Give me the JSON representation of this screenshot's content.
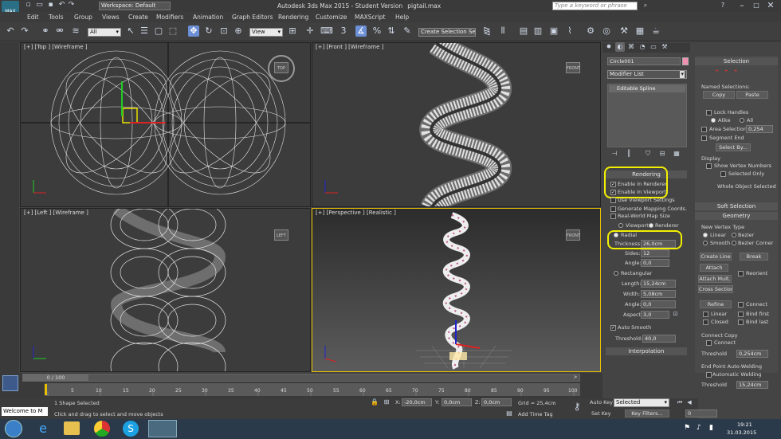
{
  "title": {
    "workspace": "Workspace: Default",
    "app": "Autodesk 3ds Max  2015  - Student Version",
    "file": "pigtail.max",
    "search_placeholder": "Type a keyword or phrase"
  },
  "menu": [
    "Edit",
    "Tools",
    "Group",
    "Views",
    "Create",
    "Modifiers",
    "Animation",
    "Graph Editors",
    "Rendering",
    "Customize",
    "MAXScript",
    "Help"
  ],
  "toolbar": {
    "filter": "All",
    "refcoord": "View",
    "selset": "Create Selection Se"
  },
  "viewports": {
    "top": "[+] [Top ] [Wireframe ]",
    "front": "[+] [Front ] [Wireframe ]",
    "left": "[+] [Left ] [Wireframe ]",
    "persp": "[+] [Perspective ] [Realistic ]"
  },
  "viewcube": {
    "top": "TOP",
    "front": "FRONT",
    "left": "LEFT",
    "persp": "FRONT"
  },
  "modify": {
    "object_name": "Circle001",
    "modifier_list": "Modifier List",
    "stack_item": "Editable Spline"
  },
  "rendering": {
    "header": "Rendering",
    "enable_renderer": "Enable In Renderer",
    "enable_viewport": "Enable In Viewport",
    "use_viewport": "Use Viewport Settings",
    "gen_mapping": "Generate Mapping Coords.",
    "real_world": "Real-World Map Size",
    "viewport": "Viewport",
    "renderer": "Renderer",
    "radial": "Radial",
    "thickness_label": "Thickness:",
    "thickness": "26,0cm",
    "sides_label": "Sides:",
    "sides": "12",
    "angle_label": "Angle:",
    "angle": "0,0",
    "rectangular": "Rectangular",
    "length_label": "Length:",
    "length": "15,24cm",
    "width_label": "Width:",
    "width": "5,08cm",
    "angle2_label": "Angle:",
    "angle2": "0,0",
    "aspect_label": "Aspect:",
    "aspect": "3,0",
    "auto_smooth": "Auto Smooth",
    "threshold_label": "Threshold:",
    "threshold": "40,0",
    "interpolation": "Interpolation"
  },
  "selection": {
    "header": "Selection",
    "named_sel": "Named Selections:",
    "copy": "Copy",
    "paste": "Paste",
    "lock_handles": "Lock Handles",
    "alike": "Alike",
    "all": "All",
    "area_sel": "Area Selection:",
    "area_val": "0,254",
    "segment_end": "Segment End",
    "select_by": "Select By...",
    "display": "Display",
    "show_vertex": "Show Vertex Numbers",
    "selected_only": "Selected Only",
    "whole_obj": "Whole Object Selected"
  },
  "soft_selection": "Soft Selection",
  "geometry": {
    "header": "Geometry",
    "new_vertex": "New Vertex Type",
    "linear": "Linear",
    "bezier": "Bezier",
    "smooth": "Smooth",
    "bezier_corner": "Bezier Corner",
    "create_line": "Create Line",
    "break": "Break",
    "attach": "Attach",
    "attach_mult": "Attach Mult.",
    "reorient": "Reorient",
    "cross_section": "Cross Section",
    "refine": "Refine",
    "connect": "Connect",
    "linear2": "Linear",
    "bind_first": "Bind first",
    "closed": "Closed",
    "bind_last": "Bind last",
    "connect_copy": "Connect Copy",
    "connect2": "Connect",
    "threshold": "Threshold",
    "threshold_val": "0,254cm",
    "endpoint": "End Point Auto-Welding",
    "auto_weld": "Automatic Welding",
    "threshold2": "Threshold",
    "threshold2_val": "15,24cm"
  },
  "timeline": {
    "frame": "0 / 100",
    "ticks": [
      "0",
      "5",
      "10",
      "15",
      "20",
      "25",
      "30",
      "35",
      "40",
      "45",
      "50",
      "55",
      "60",
      "65",
      "70",
      "75",
      "80",
      "85",
      "90",
      "95",
      "100"
    ]
  },
  "status": {
    "welcome": "Welcome to M",
    "shapes": "1 Shape Selected",
    "prompt": "Click and drag to select and move objects",
    "x_label": "X:",
    "x": "-20,0cm",
    "y_label": "Y:",
    "y": "0,0cm",
    "z_label": "Z:",
    "z": "0,0cm",
    "grid": "Grid = 25,4cm",
    "add_time_tag": "Add Time Tag",
    "auto_key": "Auto Key",
    "set_key": "Set Key",
    "selected": "Selected",
    "key_filters": "Key Filters...",
    "frame_val": "0"
  },
  "taskbar": {
    "time": "19:21",
    "date": "31.03.2015"
  },
  "colors": {
    "highlight": "#f2f000",
    "wire": "#ffffff",
    "swatch": "#f08fb0"
  }
}
